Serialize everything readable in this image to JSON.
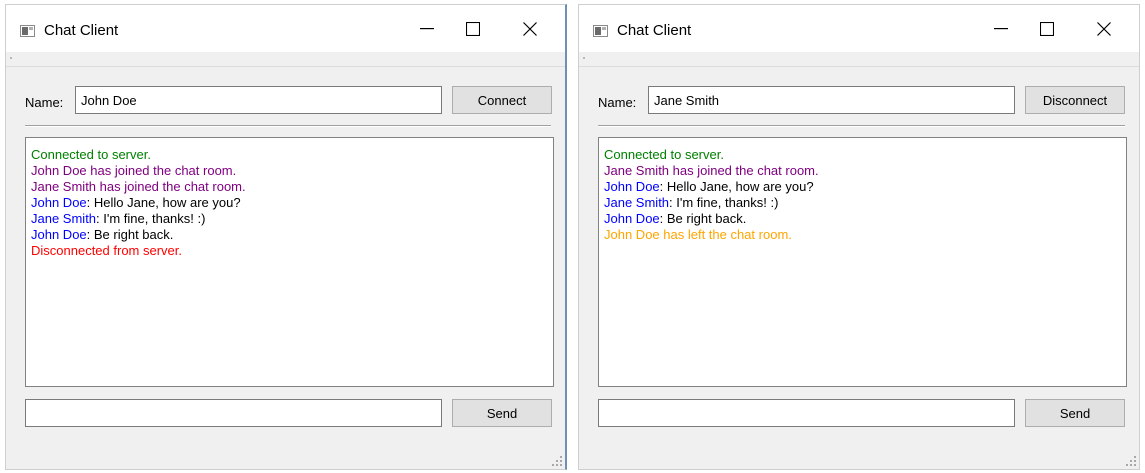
{
  "windows": [
    {
      "title": "Chat Client",
      "name_label": "Name:",
      "name_value": "John Doe",
      "action_button": "Connect",
      "send_button": "Send",
      "message_input": "",
      "log": [
        [
          {
            "text": "Connected to server.",
            "color": "#008000"
          }
        ],
        [
          {
            "text": "John Doe has joined the chat room.",
            "color": "#800080"
          }
        ],
        [
          {
            "text": "Jane Smith has joined the chat room.",
            "color": "#800080"
          }
        ],
        [
          {
            "text": "John Doe",
            "color": "#0000ff"
          },
          {
            "text": ": Hello Jane, how are you?",
            "color": "#000000"
          }
        ],
        [
          {
            "text": "Jane Smith",
            "color": "#0000ff"
          },
          {
            "text": ": I'm fine, thanks! :)",
            "color": "#000000"
          }
        ],
        [
          {
            "text": "John Doe",
            "color": "#0000ff"
          },
          {
            "text": ": Be right back.",
            "color": "#000000"
          }
        ],
        [
          {
            "text": "Disconnected from server.",
            "color": "#ff0000"
          }
        ]
      ]
    },
    {
      "title": "Chat Client",
      "name_label": "Name:",
      "name_value": "Jane Smith",
      "action_button": "Disconnect",
      "send_button": "Send",
      "message_input": "",
      "log": [
        [
          {
            "text": "Connected to server.",
            "color": "#008000"
          }
        ],
        [
          {
            "text": "Jane Smith has joined the chat room.",
            "color": "#800080"
          }
        ],
        [
          {
            "text": "John Doe",
            "color": "#0000ff"
          },
          {
            "text": ": Hello Jane, how are you?",
            "color": "#000000"
          }
        ],
        [
          {
            "text": "Jane Smith",
            "color": "#0000ff"
          },
          {
            "text": ": I'm fine, thanks! :)",
            "color": "#000000"
          }
        ],
        [
          {
            "text": "John Doe",
            "color": "#0000ff"
          },
          {
            "text": ": Be right back.",
            "color": "#000000"
          }
        ],
        [
          {
            "text": "John Doe has left the chat room.",
            "color": "#ffa500"
          }
        ]
      ]
    }
  ]
}
